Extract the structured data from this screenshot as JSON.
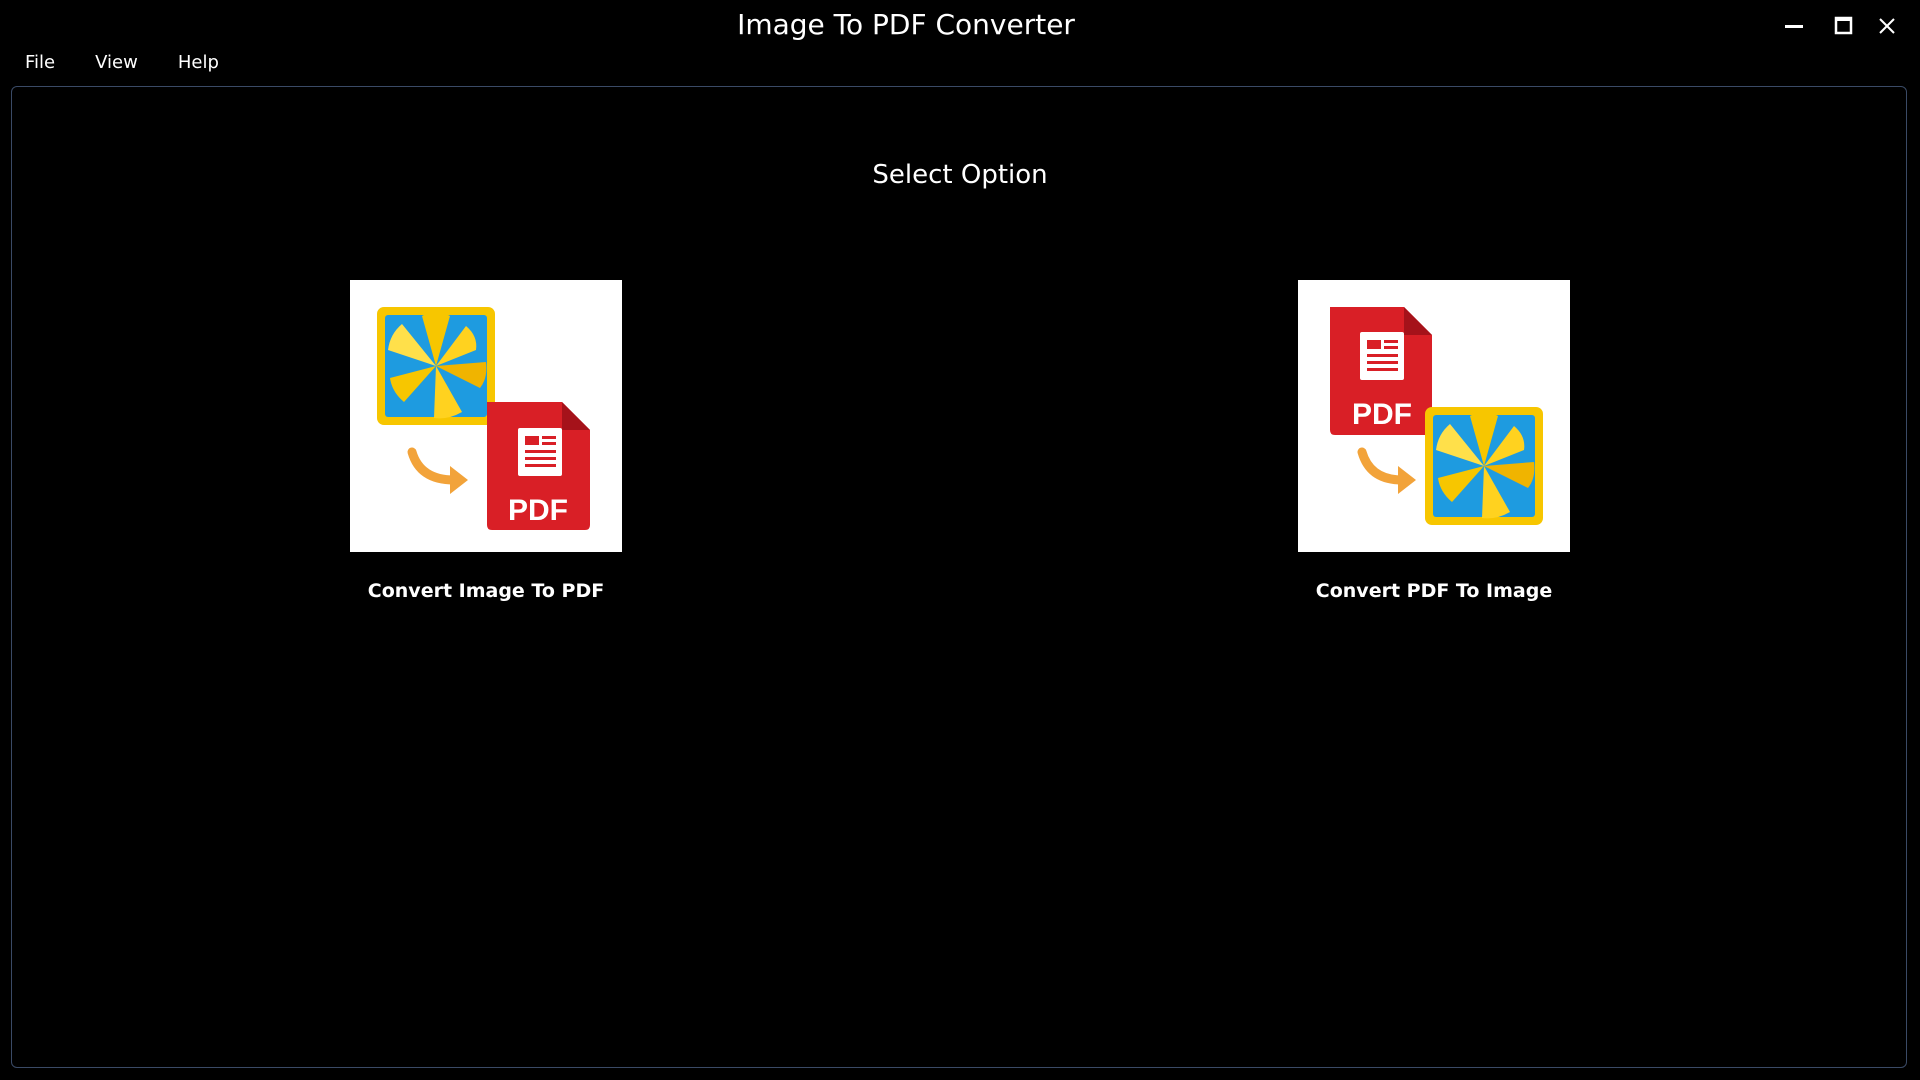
{
  "window": {
    "title": "Image To PDF Converter",
    "controls": [
      "minimize-icon",
      "maximize-icon",
      "close-icon"
    ]
  },
  "menu": {
    "items": [
      {
        "label": "File"
      },
      {
        "label": "View"
      },
      {
        "label": "Help"
      }
    ]
  },
  "main": {
    "heading": "Select Option",
    "options": [
      {
        "label": "Convert Image To PDF",
        "pdf_badge": "PDF",
        "icon": "image-to-pdf-icon"
      },
      {
        "label": "Convert PDF To Image",
        "pdf_badge": "PDF",
        "icon": "pdf-to-image-icon"
      }
    ]
  },
  "colors": {
    "background": "#000000",
    "frame_border": "#3a4a66",
    "pdf_red": "#d91f26",
    "photo_yellow": "#f7c600",
    "photo_blue": "#1e9be0",
    "arrow_orange": "#f2a33a"
  }
}
